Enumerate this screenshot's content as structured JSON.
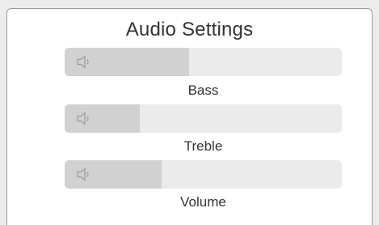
{
  "window": {
    "title": "Audio Settings"
  },
  "sliders": [
    {
      "label": "Bass",
      "level": 0.45,
      "icon": "speaker-icon"
    },
    {
      "label": "Treble",
      "level": 0.27,
      "icon": "speaker-icon"
    },
    {
      "label": "Volume",
      "level": 0.35,
      "icon": "speaker-icon"
    }
  ],
  "colors": {
    "background": "#ececec",
    "panel": "#ffffff",
    "track": "#ebebeb",
    "fill": "#d1d1d1",
    "text": "#333333",
    "icon": "#9a9a9a"
  }
}
